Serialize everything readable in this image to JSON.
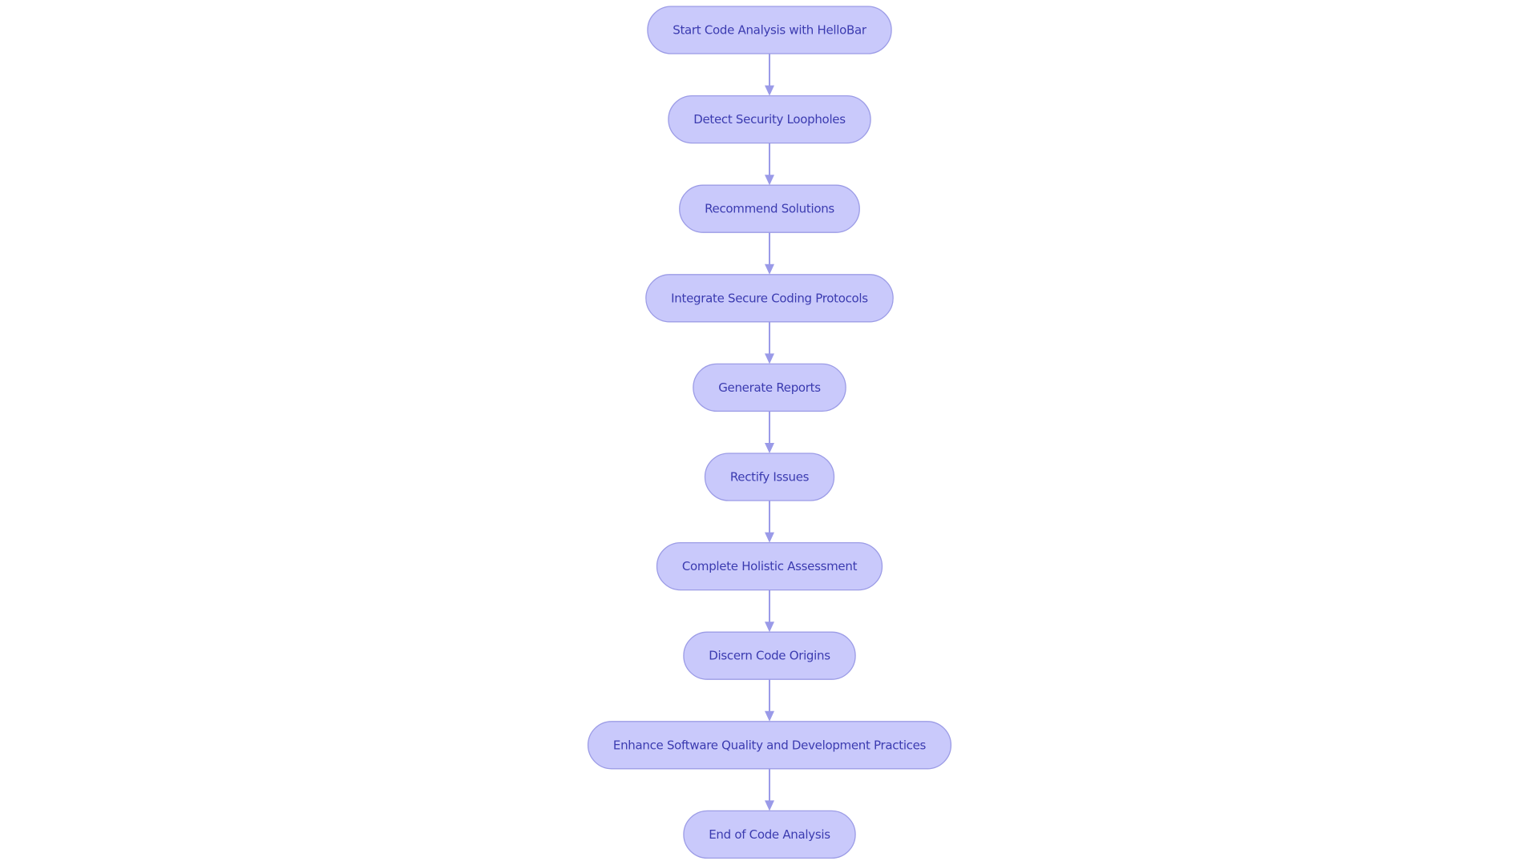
{
  "diagram": {
    "type": "flowchart",
    "direction": "top-to-bottom",
    "colors": {
      "node_fill": "#c9c9fb",
      "node_border": "#9c9ce6",
      "node_text": "#3b3bb0",
      "edge": "#9a9ae8"
    },
    "nodes": [
      {
        "id": "n1",
        "label": "Start Code Analysis with HelloBar"
      },
      {
        "id": "n2",
        "label": "Detect Security Loopholes"
      },
      {
        "id": "n3",
        "label": "Recommend Solutions"
      },
      {
        "id": "n4",
        "label": "Integrate Secure Coding Protocols"
      },
      {
        "id": "n5",
        "label": "Generate Reports"
      },
      {
        "id": "n6",
        "label": "Rectify Issues"
      },
      {
        "id": "n7",
        "label": "Complete Holistic Assessment"
      },
      {
        "id": "n8",
        "label": "Discern Code Origins"
      },
      {
        "id": "n9",
        "label": "Enhance Software Quality and Development Practices"
      },
      {
        "id": "n10",
        "label": "End of Code Analysis"
      }
    ],
    "edges": [
      {
        "from": "n1",
        "to": "n2"
      },
      {
        "from": "n2",
        "to": "n3"
      },
      {
        "from": "n3",
        "to": "n4"
      },
      {
        "from": "n4",
        "to": "n5"
      },
      {
        "from": "n5",
        "to": "n6"
      },
      {
        "from": "n6",
        "to": "n7"
      },
      {
        "from": "n7",
        "to": "n8"
      },
      {
        "from": "n8",
        "to": "n9"
      },
      {
        "from": "n9",
        "to": "n10"
      }
    ]
  }
}
